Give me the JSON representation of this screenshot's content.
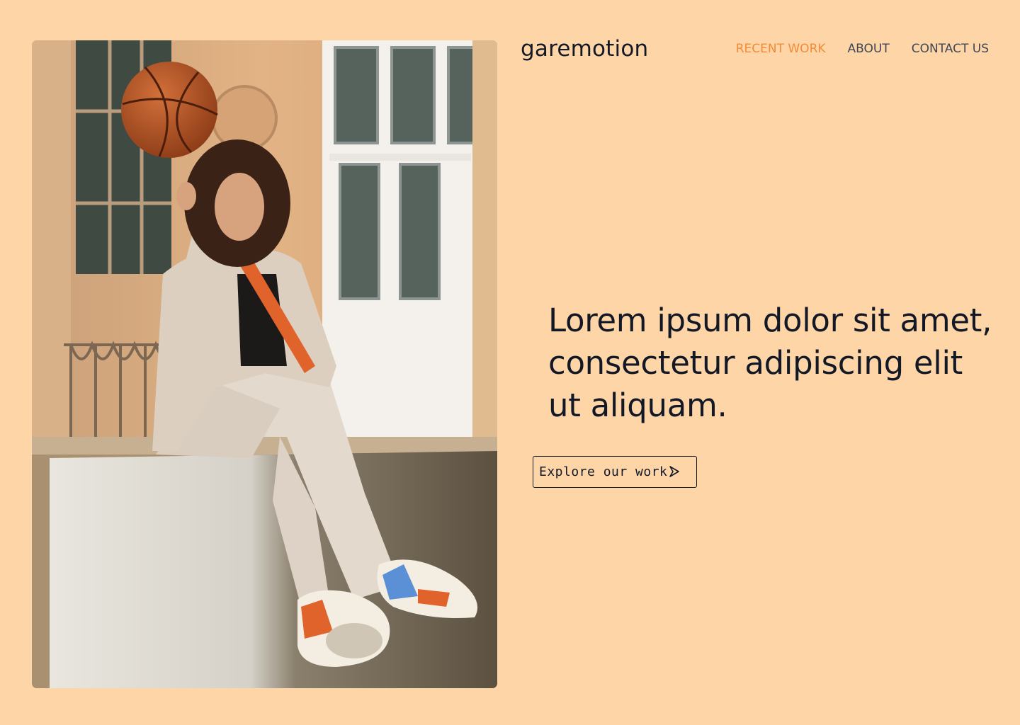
{
  "header": {
    "brand": "garemotion",
    "nav": [
      {
        "label": "RECENT WORK",
        "active": true
      },
      {
        "label": "ABOUT",
        "active": false
      },
      {
        "label": "CONTACT US",
        "active": false
      }
    ]
  },
  "hero": {
    "headline": "Lorem ipsum dolor sit amet, consectetur adipiscing elit ut aliquam.",
    "cta_label": "Explore our work",
    "cta_icon": "arrow-right-icon",
    "photo_icon": "hero-photo"
  },
  "colors": {
    "background": "#FED5A6",
    "text": "#121826",
    "nav_text": "#3F4656",
    "accent": "#F28C3B"
  }
}
